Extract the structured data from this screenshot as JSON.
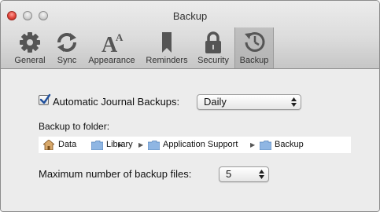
{
  "window": {
    "title": "Backup"
  },
  "toolbar": {
    "tabs": [
      {
        "label": "General",
        "icon": "gear-icon"
      },
      {
        "label": "Sync",
        "icon": "sync-arrows-icon"
      },
      {
        "label": "Appearance",
        "icon": "font-icon"
      },
      {
        "label": "Reminders",
        "icon": "bookmark-icon"
      },
      {
        "label": "Security",
        "icon": "lock-icon"
      },
      {
        "label": "Backup",
        "icon": "time-machine-icon"
      }
    ],
    "active_tab": "Backup"
  },
  "backup": {
    "auto_label": "Automatic Journal Backups:",
    "auto_checked": true,
    "frequency_value": "Daily",
    "folder_label": "Backup to folder:",
    "path": [
      {
        "label": "Data",
        "icon": "home-icon"
      },
      {
        "label": "Library",
        "icon": "folder-icon"
      },
      {
        "label": "Application Support",
        "icon": "folder-icon"
      },
      {
        "label": "Backup",
        "icon": "folder-icon"
      }
    ],
    "path_separator": "▶",
    "max_label": "Maximum number of backup files:",
    "max_value": "5"
  },
  "colors": {
    "checkbox_accent": "#3a73c8",
    "folder_blue": "#8fb6e3"
  }
}
